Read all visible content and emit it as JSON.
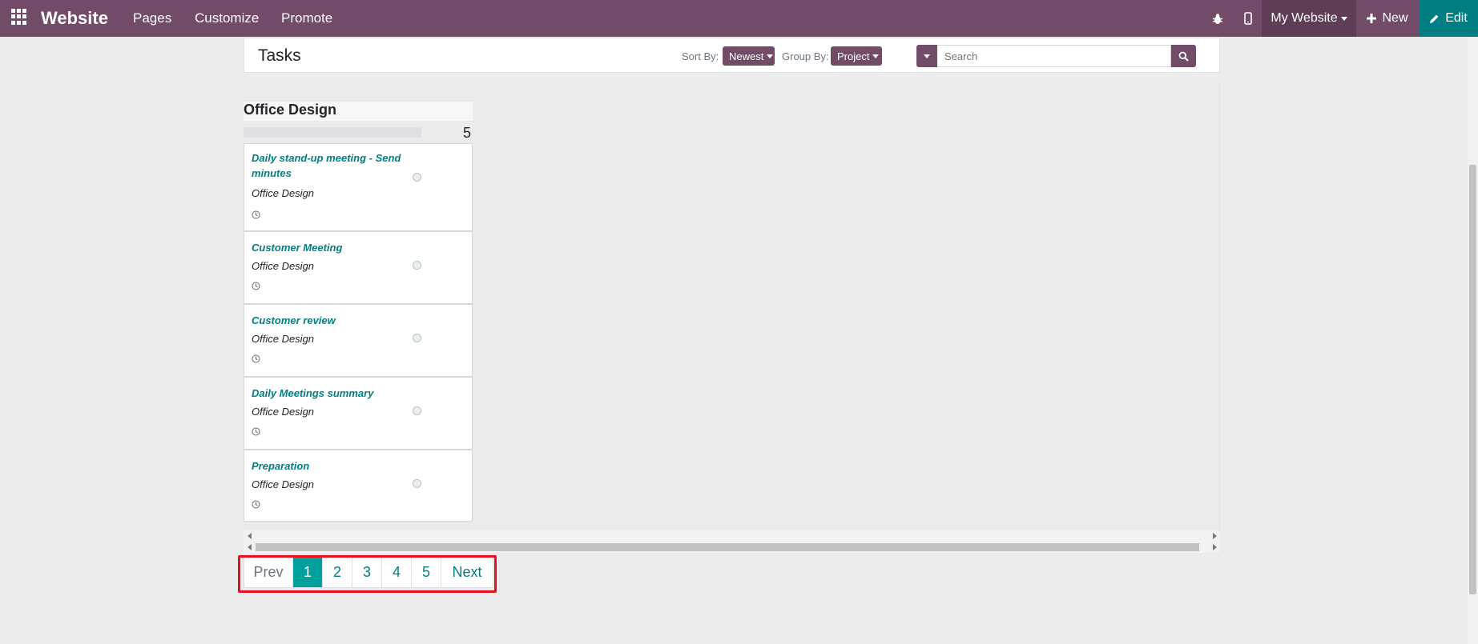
{
  "navbar": {
    "apps_icon": "apps-grid-icon",
    "brand": "Website",
    "menu": [
      "Pages",
      "Customize",
      "Promote"
    ],
    "debug_icon": "bug-icon",
    "mobile_icon": "mobile-phone-icon",
    "website_selector": "My Website",
    "new_label": "New",
    "edit_label": "Edit",
    "colors": {
      "bar": "#714b67",
      "edit": "#017e84"
    }
  },
  "header": {
    "title": "Tasks",
    "sort_label": "Sort By:",
    "sort_value": "Newest",
    "group_label": "Group By:",
    "group_value": "Project",
    "search_placeholder": "Search"
  },
  "column": {
    "title": "Office Design",
    "count": "5",
    "tasks": [
      {
        "name": "Daily stand-up meeting - Send minutes",
        "project": "Office Design"
      },
      {
        "name": "Customer Meeting",
        "project": "Office Design"
      },
      {
        "name": "Customer review",
        "project": "Office Design"
      },
      {
        "name": "Daily Meetings summary",
        "project": "Office Design"
      },
      {
        "name": "Preparation",
        "project": "Office Design"
      }
    ]
  },
  "pagination": {
    "prev": "Prev",
    "pages": [
      "1",
      "2",
      "3",
      "4",
      "5"
    ],
    "active": "1",
    "next": "Next",
    "accent": "#00a09d"
  }
}
